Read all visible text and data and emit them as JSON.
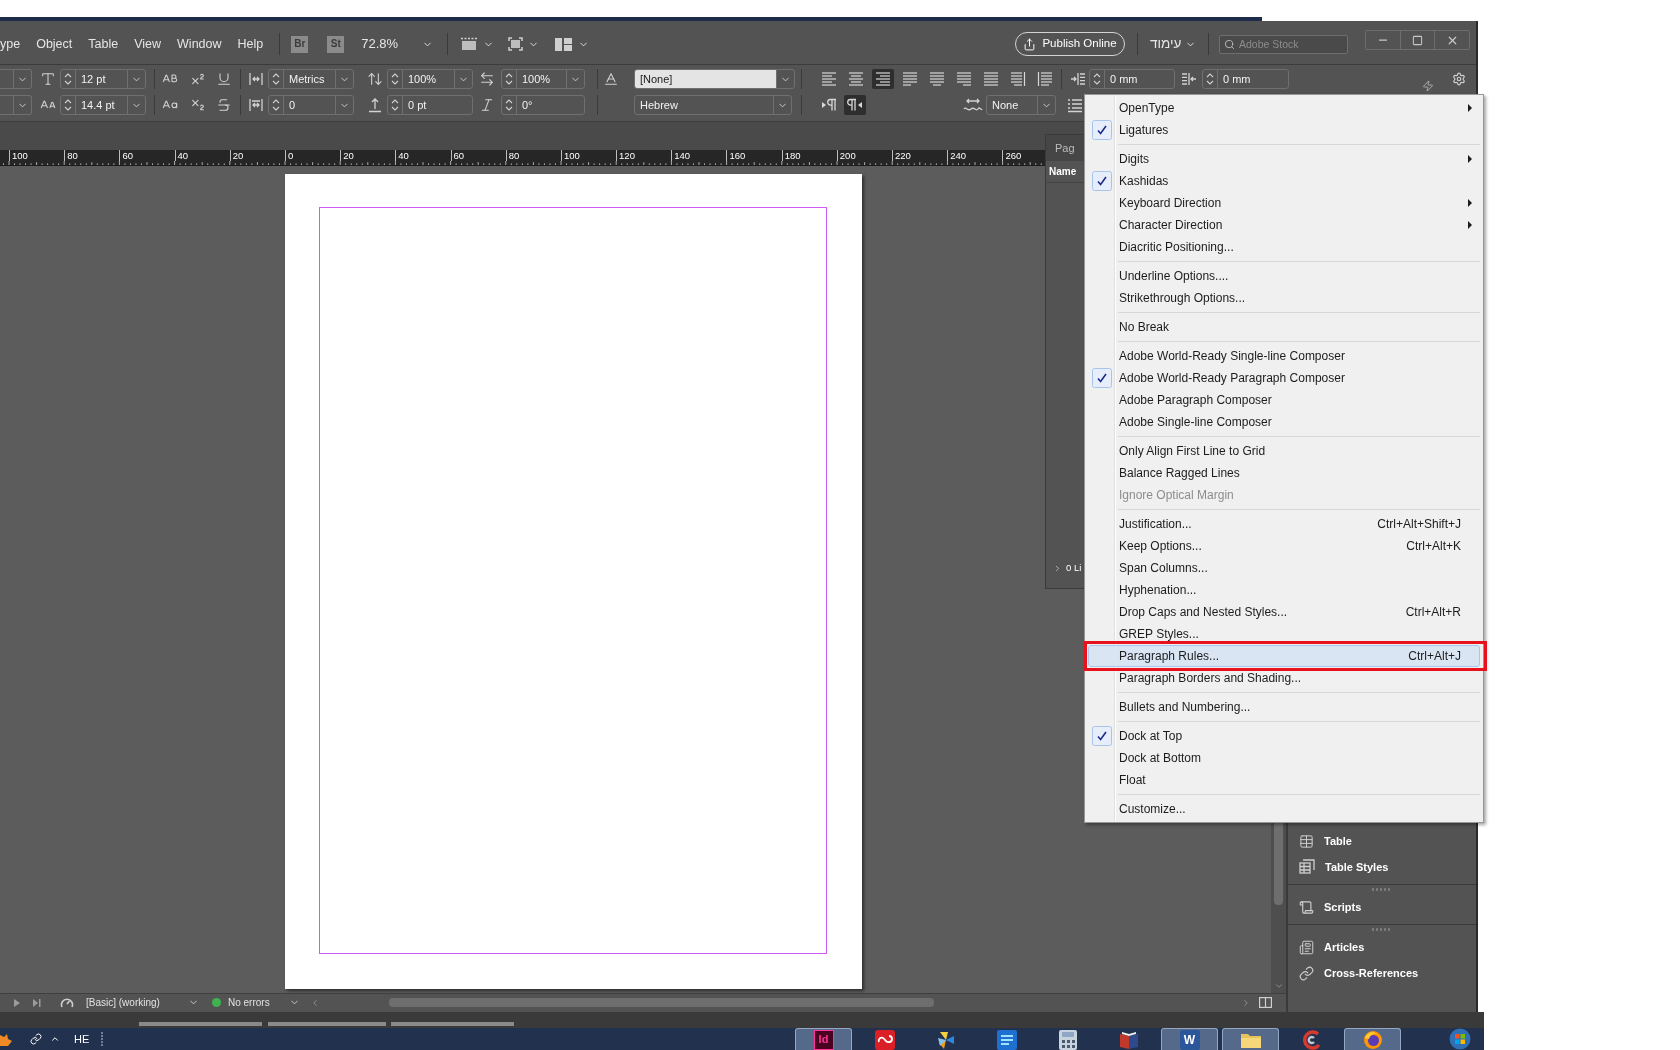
{
  "menubar": {
    "items": [
      "ype",
      "Object",
      "Table",
      "View",
      "Window",
      "Help"
    ],
    "bridge": "Br",
    "stock": "St",
    "zoom": "72.8%"
  },
  "title_controls": {
    "publish": "Publish Online",
    "workspace": "עימוד",
    "search_placeholder": "Adobe Stock"
  },
  "character": {
    "font_size": "12 pt",
    "leading": "14.4 pt",
    "kerning": "Metrics",
    "tracking": "0",
    "vertical_scale": "100%",
    "horizontal_scale": "100%",
    "baseline_shift": "0 pt",
    "skew": "0°",
    "character_style": "[None]",
    "language": "Hebrew"
  },
  "paragraph": {
    "alignments": [
      {
        "kind": "left",
        "selected": false
      },
      {
        "kind": "center",
        "selected": false
      },
      {
        "kind": "right",
        "selected": true
      },
      {
        "kind": "justify_left",
        "selected": false
      },
      {
        "kind": "justify_center",
        "selected": false
      },
      {
        "kind": "justify_right",
        "selected": false
      },
      {
        "kind": "justify_all",
        "selected": false
      },
      {
        "kind": "toward_spine",
        "selected": false
      },
      {
        "kind": "away_spine",
        "selected": false
      }
    ],
    "directions": [
      {
        "kind": "ltr",
        "selected": false
      },
      {
        "kind": "rtl",
        "selected": true
      }
    ],
    "left_indent": "0 mm",
    "right_indent": "0 mm",
    "justification": "None"
  },
  "ruler": {
    "labels": [
      "100",
      "80",
      "60",
      "40",
      "20",
      "0",
      "20",
      "40",
      "60",
      "80",
      "100",
      "120",
      "140",
      "160",
      "180",
      "200",
      "220",
      "240",
      "260"
    ]
  },
  "pages_panel": {
    "tab": "Pag",
    "column": "Name",
    "footer": "0 Li"
  },
  "context_menu": {
    "groups": [
      [
        {
          "label": "OpenType",
          "checked": false,
          "disabled": false,
          "submenu": true,
          "selected": false,
          "outlined": false
        },
        {
          "label": "Ligatures",
          "checked": true,
          "disabled": false,
          "submenu": false,
          "selected": false,
          "outlined": false
        }
      ],
      [
        {
          "label": "Digits",
          "checked": false,
          "disabled": false,
          "submenu": true,
          "selected": false,
          "outlined": false
        },
        {
          "label": "Kashidas",
          "checked": true,
          "disabled": false,
          "submenu": false,
          "selected": false,
          "outlined": false
        },
        {
          "label": "Keyboard Direction",
          "checked": false,
          "disabled": false,
          "submenu": true,
          "selected": false,
          "outlined": false
        },
        {
          "label": "Character Direction",
          "checked": false,
          "disabled": false,
          "submenu": true,
          "selected": false,
          "outlined": false
        },
        {
          "label": "Diacritic Positioning...",
          "checked": false,
          "disabled": false,
          "submenu": false,
          "selected": false,
          "outlined": false
        }
      ],
      [
        {
          "label": "Underline Options....",
          "checked": false,
          "disabled": false,
          "submenu": false,
          "selected": false,
          "outlined": false
        },
        {
          "label": "Strikethrough Options...",
          "checked": false,
          "disabled": false,
          "submenu": false,
          "selected": false,
          "outlined": false
        }
      ],
      [
        {
          "label": "No Break",
          "checked": false,
          "disabled": false,
          "submenu": false,
          "selected": false,
          "outlined": false
        }
      ],
      [
        {
          "label": "Adobe World-Ready Single-line Composer",
          "checked": false,
          "disabled": false,
          "submenu": false,
          "selected": false,
          "outlined": false
        },
        {
          "label": "Adobe World-Ready Paragraph Composer",
          "checked": true,
          "disabled": false,
          "submenu": false,
          "selected": false,
          "outlined": false
        },
        {
          "label": "Adobe Paragraph Composer",
          "checked": false,
          "disabled": false,
          "submenu": false,
          "selected": false,
          "outlined": false
        },
        {
          "label": "Adobe Single-line Composer",
          "checked": false,
          "disabled": false,
          "submenu": false,
          "selected": false,
          "outlined": false
        }
      ],
      [
        {
          "label": "Only Align First Line to Grid",
          "checked": false,
          "disabled": false,
          "submenu": false,
          "selected": false,
          "outlined": false
        },
        {
          "label": "Balance Ragged Lines",
          "checked": false,
          "disabled": false,
          "submenu": false,
          "selected": false,
          "outlined": false
        },
        {
          "label": "Ignore Optical Margin",
          "checked": false,
          "disabled": true,
          "submenu": false,
          "selected": false,
          "outlined": false
        }
      ],
      [
        {
          "label": "Justification...",
          "shortcut": "Ctrl+Alt+Shift+J",
          "checked": false,
          "disabled": false,
          "submenu": false,
          "selected": false,
          "outlined": false
        },
        {
          "label": "Keep Options...",
          "shortcut": "Ctrl+Alt+K",
          "checked": false,
          "disabled": false,
          "submenu": false,
          "selected": false,
          "outlined": false
        },
        {
          "label": "Span Columns...",
          "checked": false,
          "disabled": false,
          "submenu": false,
          "selected": false,
          "outlined": false
        },
        {
          "label": "Hyphenation...",
          "checked": false,
          "disabled": false,
          "submenu": false,
          "selected": false,
          "outlined": false
        },
        {
          "label": "Drop Caps and Nested Styles...",
          "shortcut": "Ctrl+Alt+R",
          "checked": false,
          "disabled": false,
          "submenu": false,
          "selected": false,
          "outlined": false
        },
        {
          "label": "GREP Styles...",
          "checked": false,
          "disabled": false,
          "submenu": false,
          "selected": false,
          "outlined": false
        },
        {
          "label": "Paragraph Rules...",
          "shortcut": "Ctrl+Alt+J",
          "checked": false,
          "disabled": false,
          "submenu": false,
          "selected": true,
          "outlined": true
        },
        {
          "label": "Paragraph Borders and Shading...",
          "checked": false,
          "disabled": false,
          "submenu": false,
          "selected": false,
          "outlined": false
        }
      ],
      [
        {
          "label": "Bullets and Numbering...",
          "checked": false,
          "disabled": false,
          "submenu": false,
          "selected": false,
          "outlined": false
        }
      ],
      [
        {
          "label": "Dock at Top",
          "checked": true,
          "disabled": false,
          "submenu": false,
          "selected": false,
          "outlined": false
        },
        {
          "label": "Dock at Bottom",
          "checked": false,
          "disabled": false,
          "submenu": false,
          "selected": false,
          "outlined": false
        },
        {
          "label": "Float",
          "checked": false,
          "disabled": false,
          "submenu": false,
          "selected": false,
          "outlined": false
        }
      ],
      [
        {
          "label": "Customize...",
          "checked": false,
          "disabled": false,
          "submenu": false,
          "selected": false,
          "outlined": false
        }
      ]
    ]
  },
  "side_panel": {
    "groups": [
      [
        {
          "kind": "table",
          "label": "Table"
        },
        {
          "kind": "table_styles",
          "label": "Table Styles"
        }
      ],
      [
        {
          "kind": "scripts",
          "label": "Scripts"
        }
      ],
      [
        {
          "kind": "articles",
          "label": "Articles"
        },
        {
          "kind": "cross_references",
          "label": "Cross-References"
        }
      ]
    ]
  },
  "status_bar": {
    "profile": "[Basic] (working)",
    "errors": "No errors"
  },
  "taskbar": {
    "language": "HE",
    "apps": [
      {
        "kind": "indesign",
        "label": "Id",
        "active": true
      },
      {
        "kind": "creative_cloud",
        "active": false
      },
      {
        "kind": "pinwheel",
        "active": false
      },
      {
        "kind": "blue_tile",
        "active": false
      },
      {
        "kind": "calculator",
        "active": false
      },
      {
        "kind": "book",
        "active": false
      },
      {
        "kind": "word",
        "label": "W",
        "active": true
      },
      {
        "kind": "folder",
        "active": true
      },
      {
        "kind": "swirl",
        "active": false
      },
      {
        "kind": "firefox",
        "active": true
      }
    ]
  }
}
